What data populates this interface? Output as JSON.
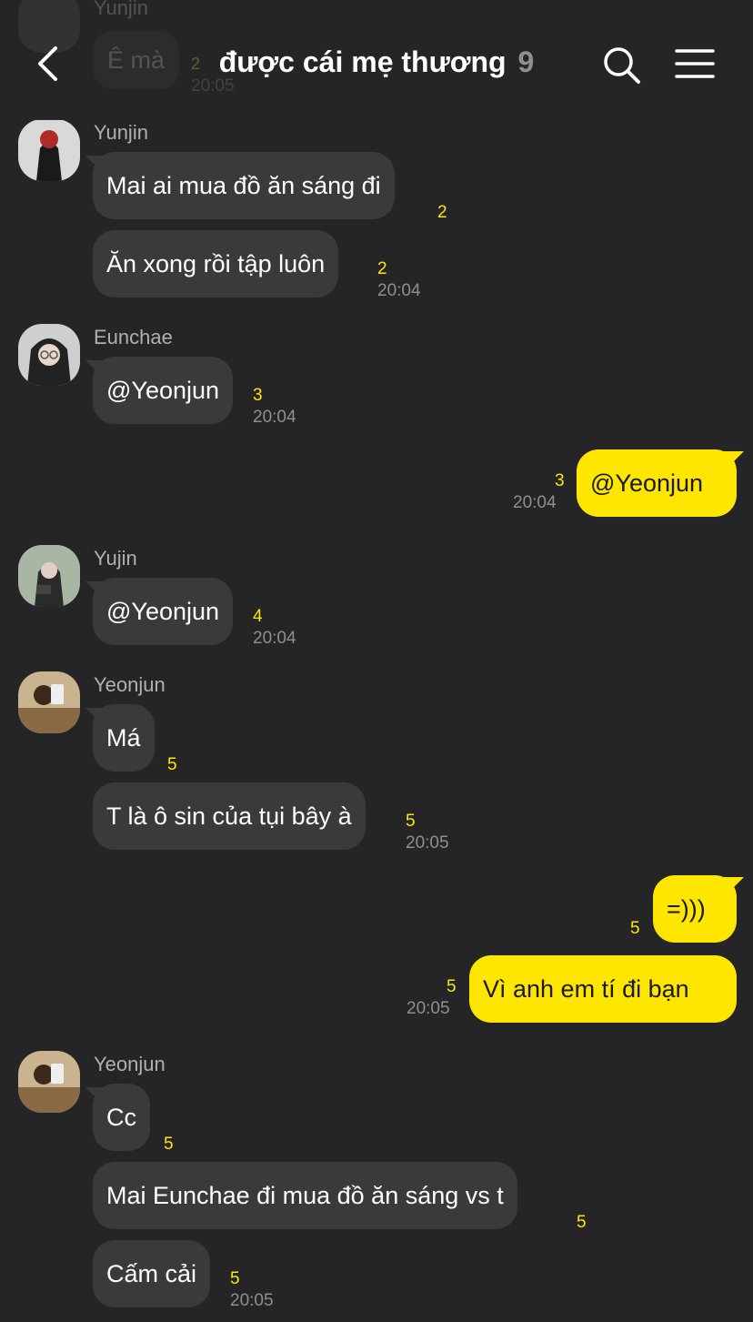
{
  "header": {
    "title": "được cái mẹ thương",
    "member_count": "9",
    "back_icon": "chevron-left-icon",
    "search_icon": "search-icon",
    "menu_icon": "hamburger-menu-icon"
  },
  "previous_message": {
    "sender": "Yunjin",
    "text": "Ê mà",
    "unread": "2",
    "time": "20:05"
  },
  "messages": {
    "yunjin_name": "Yunjin",
    "m1_text": "Mai ai mua đồ ăn sáng đi",
    "m1_unread": "2",
    "m2_text": "Ăn xong rồi tập luôn",
    "m2_unread": "2",
    "m2_time": "20:04",
    "eunchae_name": "Eunchae",
    "m3_text": "@Yeonjun",
    "m3_unread": "3",
    "m3_time": "20:04",
    "m4_text": "@Yeonjun",
    "m4_unread": "3",
    "m4_time": "20:04",
    "yujin_name": "Yujin",
    "m5_text": "@Yeonjun",
    "m5_unread": "4",
    "m5_time": "20:04",
    "yeonjun_name": "Yeonjun",
    "m6_text": "Má",
    "m6_unread": "5",
    "m7_text": "T là ô sin của tụi bây à",
    "m7_unread": "5",
    "m7_time": "20:05",
    "m8_text": "=)))",
    "m8_unread": "5",
    "m9_text": "Vì anh em tí đi bạn",
    "m9_unread": "5",
    "m9_time": "20:05",
    "yeonjun2_name": "Yeonjun",
    "m10_text": "Cc",
    "m10_unread": "5",
    "m11_text": "Mai Eunchae đi mua đồ ăn sáng vs t",
    "m11_unread": "5",
    "m12_text": "Cấm cải",
    "m12_unread": "5",
    "m12_time": "20:05"
  },
  "colors": {
    "background": "#252527",
    "incoming_bubble": "#3a3a3c",
    "outgoing_bubble": "#ffe600",
    "unread_count": "#ffe600",
    "timestamp": "#8e8e93"
  }
}
